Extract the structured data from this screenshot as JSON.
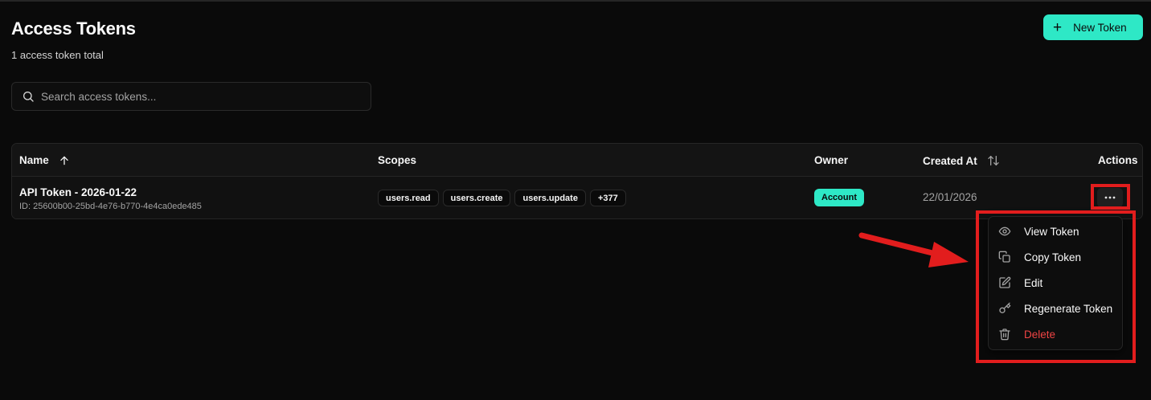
{
  "header": {
    "title": "Access Tokens",
    "subtitle": "1 access token total",
    "new_button_icon": "+",
    "new_button_label": "New Token"
  },
  "search": {
    "placeholder": "Search access tokens...",
    "value": ""
  },
  "table": {
    "columns": {
      "name": "Name",
      "scopes": "Scopes",
      "owner": "Owner",
      "created_at": "Created At",
      "actions": "Actions"
    },
    "rows": [
      {
        "name": "API Token - 2026-01-22",
        "id": "ID: 25600b00-25bd-4e76-b770-4e4ca0ede485",
        "scopes": [
          "users.read",
          "users.create",
          "users.update"
        ],
        "scopes_more": "+377",
        "owner": "Account",
        "created_at": "22/01/2026",
        "actions_icon": "···"
      }
    ]
  },
  "action_menu": {
    "items": [
      {
        "label": "View Token",
        "icon": "eye-icon"
      },
      {
        "label": "Copy Token",
        "icon": "copy-icon"
      },
      {
        "label": "Edit",
        "icon": "edit-icon"
      },
      {
        "label": "Regenerate Token",
        "icon": "key-icon"
      },
      {
        "label": "Delete",
        "icon": "trash-icon"
      }
    ]
  },
  "colors": {
    "background": "#0a0a0a",
    "accent": "#2ee8c6",
    "danger": "#ef4444",
    "annotation": "#e21d1d"
  }
}
